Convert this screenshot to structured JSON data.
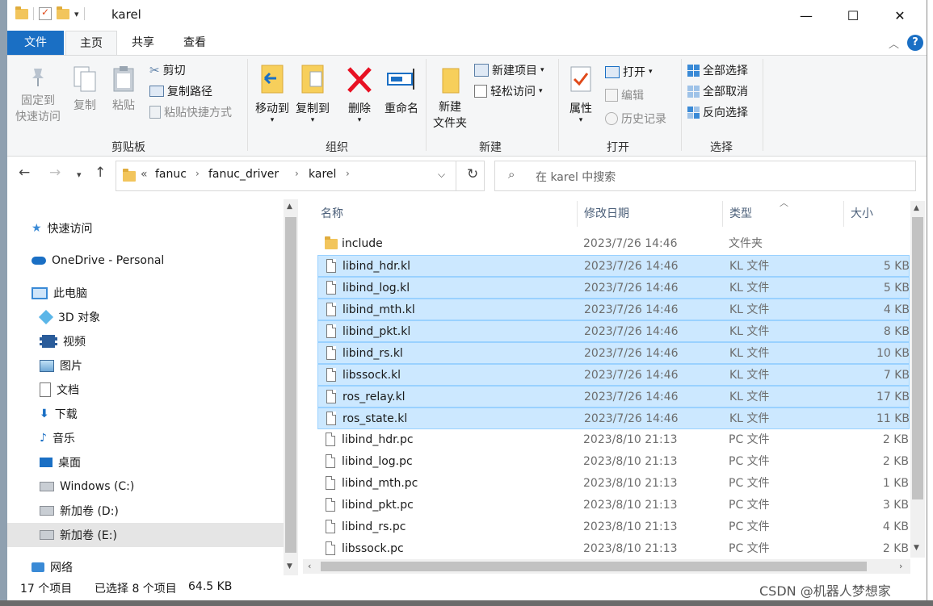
{
  "window": {
    "title": "karel",
    "controls": {
      "minimize": "—",
      "maximize": "☐",
      "close": "✕"
    }
  },
  "ribbon": {
    "tabs": [
      "文件",
      "主页",
      "共享",
      "查看"
    ],
    "help_label": "?",
    "clipboard": {
      "group_label": "剪贴板",
      "pin": "固定到\n快速访问",
      "copy": "复制",
      "paste": "粘贴",
      "cut": "剪切",
      "copy_path": "复制路径",
      "paste_shortcut": "粘贴快捷方式"
    },
    "organize": {
      "group_label": "组织",
      "move_to": "移动到",
      "copy_to": "复制到",
      "delete": "删除",
      "rename": "重命名"
    },
    "new": {
      "group_label": "新建",
      "new_folder": "新建\n文件夹",
      "new_item": "新建项目",
      "easy_access": "轻松访问"
    },
    "open": {
      "group_label": "打开",
      "properties": "属性",
      "open": "打开",
      "edit": "编辑",
      "history": "历史记录"
    },
    "select": {
      "group_label": "选择",
      "select_all": "全部选择",
      "select_none": "全部取消",
      "invert": "反向选择"
    }
  },
  "address": {
    "overflow": "«",
    "crumbs": [
      "fanuc",
      "fanuc_driver",
      "karel"
    ],
    "search_placeholder": "在 karel 中搜索"
  },
  "nav_pane": {
    "items": [
      {
        "label": "快速访问",
        "icon": "star-icon"
      },
      {
        "label": "OneDrive - Personal",
        "icon": "cloud-icon"
      },
      {
        "label": "此电脑",
        "icon": "computer-icon"
      },
      {
        "label": "3D 对象",
        "icon": "cube-icon"
      },
      {
        "label": "视频",
        "icon": "video-icon"
      },
      {
        "label": "图片",
        "icon": "picture-icon"
      },
      {
        "label": "文档",
        "icon": "document-icon"
      },
      {
        "label": "下载",
        "icon": "download-icon"
      },
      {
        "label": "音乐",
        "icon": "music-icon"
      },
      {
        "label": "桌面",
        "icon": "desktop-icon"
      },
      {
        "label": "Windows (C:)",
        "icon": "drive-icon"
      },
      {
        "label": "新加卷 (D:)",
        "icon": "drive-icon"
      },
      {
        "label": "新加卷 (E:)",
        "icon": "drive-icon"
      },
      {
        "label": "网络",
        "icon": "network-icon"
      }
    ]
  },
  "file_list": {
    "columns": [
      "名称",
      "修改日期",
      "类型",
      "大小"
    ],
    "rows": [
      {
        "name": "include",
        "date": "2023/7/26 14:46",
        "type": "文件夹",
        "size": "",
        "kind": "folder",
        "selected": false
      },
      {
        "name": "libind_hdr.kl",
        "date": "2023/7/26 14:46",
        "type": "KL 文件",
        "size": "5 KB",
        "kind": "file",
        "selected": true
      },
      {
        "name": "libind_log.kl",
        "date": "2023/7/26 14:46",
        "type": "KL 文件",
        "size": "5 KB",
        "kind": "file",
        "selected": true
      },
      {
        "name": "libind_mth.kl",
        "date": "2023/7/26 14:46",
        "type": "KL 文件",
        "size": "4 KB",
        "kind": "file",
        "selected": true
      },
      {
        "name": "libind_pkt.kl",
        "date": "2023/7/26 14:46",
        "type": "KL 文件",
        "size": "8 KB",
        "kind": "file",
        "selected": true
      },
      {
        "name": "libind_rs.kl",
        "date": "2023/7/26 14:46",
        "type": "KL 文件",
        "size": "10 KB",
        "kind": "file",
        "selected": true
      },
      {
        "name": "libssock.kl",
        "date": "2023/7/26 14:46",
        "type": "KL 文件",
        "size": "7 KB",
        "kind": "file",
        "selected": true
      },
      {
        "name": "ros_relay.kl",
        "date": "2023/7/26 14:46",
        "type": "KL 文件",
        "size": "17 KB",
        "kind": "file",
        "selected": true
      },
      {
        "name": "ros_state.kl",
        "date": "2023/7/26 14:46",
        "type": "KL 文件",
        "size": "11 KB",
        "kind": "file",
        "selected": true
      },
      {
        "name": "libind_hdr.pc",
        "date": "2023/8/10 21:13",
        "type": "PC 文件",
        "size": "2 KB",
        "kind": "file",
        "selected": false
      },
      {
        "name": "libind_log.pc",
        "date": "2023/8/10 21:13",
        "type": "PC 文件",
        "size": "2 KB",
        "kind": "file",
        "selected": false
      },
      {
        "name": "libind_mth.pc",
        "date": "2023/8/10 21:13",
        "type": "PC 文件",
        "size": "1 KB",
        "kind": "file",
        "selected": false
      },
      {
        "name": "libind_pkt.pc",
        "date": "2023/8/10 21:13",
        "type": "PC 文件",
        "size": "3 KB",
        "kind": "file",
        "selected": false
      },
      {
        "name": "libind_rs.pc",
        "date": "2023/8/10 21:13",
        "type": "PC 文件",
        "size": "4 KB",
        "kind": "file",
        "selected": false
      },
      {
        "name": "libssock.pc",
        "date": "2023/8/10 21:13",
        "type": "PC 文件",
        "size": "2 KB",
        "kind": "file",
        "selected": false
      }
    ]
  },
  "status_bar": {
    "item_count": "17 个项目",
    "selection": "已选择 8 个项目",
    "selection_size": "64.5 KB"
  },
  "watermark": "CSDN @机器人梦想家",
  "colors": {
    "accent": "#1a6fc4",
    "selection_bg": "#cce8ff",
    "selection_border": "#99d1ff",
    "folder": "#f2c55c",
    "delete_red": "#e81123"
  }
}
